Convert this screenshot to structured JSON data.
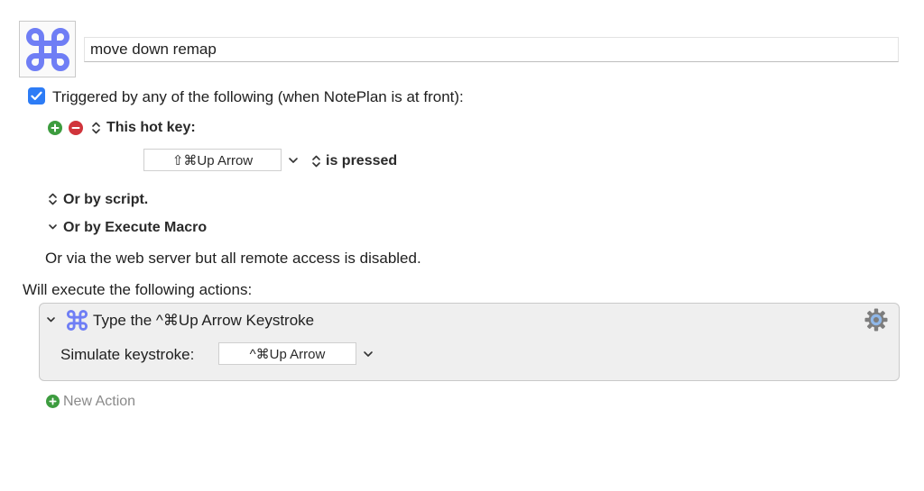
{
  "macro": {
    "name": "move down remap",
    "icon": "command-key-icon",
    "icon_color": "#6f7ef5"
  },
  "trigger": {
    "checked": true,
    "label": "Triggered by any of the following (when NotePlan is at front):",
    "hotkey": {
      "label": "This hot key:",
      "value": "⇧⌘Up Arrow",
      "state": "is pressed"
    },
    "by_script": "Or by script.",
    "by_execute_macro": "Or by Execute Macro",
    "web_server": "Or via the web server but all remote access is disabled."
  },
  "actions": {
    "heading": "Will execute the following actions:",
    "items": [
      {
        "title": "Type the ^⌘Up Arrow Keystroke",
        "simulate_label": "Simulate keystroke:",
        "keystroke": "^⌘Up Arrow"
      }
    ],
    "new_action": "New Action"
  },
  "colors": {
    "accent": "#2d7cf6",
    "add": "#3d9c3f",
    "remove": "#d0343b",
    "command_icon": "#6f7ef5"
  }
}
